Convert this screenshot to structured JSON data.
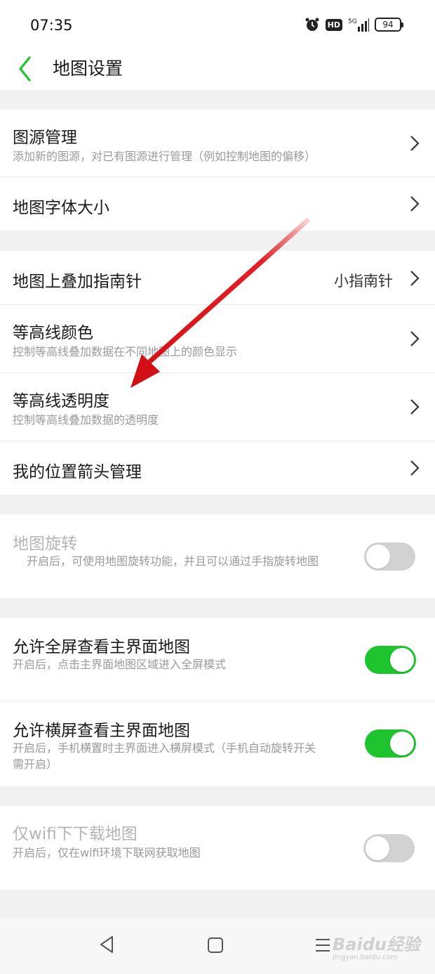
{
  "status_bar": {
    "time": "07:35",
    "hd_label": "HD",
    "network_label": "5G",
    "battery": "94",
    "icons": [
      "alarm-icon",
      "hd-icon",
      "signal-icon",
      "battery-icon"
    ]
  },
  "header": {
    "title": "地图设置",
    "back_icon": "chevron-left-icon",
    "accent_color": "#1dc42d"
  },
  "sections": [
    {
      "rows": [
        {
          "title": "图源管理",
          "subtitle": "添加新的图源，对已有图源进行管理（例如控制地图的偏移）"
        },
        {
          "title": "地图字体大小"
        }
      ]
    },
    {
      "rows": [
        {
          "title": "地图上叠加指南针",
          "value": "小指南针"
        },
        {
          "title": "等高线颜色",
          "subtitle": "控制等高线叠加数据在不同地图上的颜色显示"
        },
        {
          "title": "等高线透明度",
          "subtitle": "控制等高线叠加数据的透明度"
        },
        {
          "title": "我的位置箭头管理"
        }
      ]
    },
    {
      "rows": [
        {
          "title": "地图旋转",
          "subtitle": "开启后，可使用地图旋转功能，并且可以通过手指旋转地图",
          "toggle": false,
          "disabled": true
        }
      ]
    },
    {
      "rows": [
        {
          "title": "允许全屏查看主界面地图",
          "subtitle": "开启后，点击主界面地图区域进入全屏模式",
          "toggle": true
        },
        {
          "title": "允许横屏查看主界面地图",
          "subtitle_line1": "开启后，手机横置时主界面进入横屏模式（手机自动旋转开关",
          "subtitle_line2": "需开启）",
          "toggle": true
        }
      ]
    },
    {
      "rows": [
        {
          "title": "仅wifi下下载地图",
          "subtitle": "开启后，仅在wifi环境下联网获取地图",
          "toggle": false,
          "disabled": true
        }
      ]
    }
  ],
  "annotation": {
    "arrow_color": "#e0141a"
  },
  "navbar": {
    "icons": [
      "nav-back-icon",
      "nav-home-icon",
      "nav-menu-icon"
    ]
  },
  "watermark": {
    "main": "Baidu经验",
    "sub": "jingyan.baidu.com"
  }
}
